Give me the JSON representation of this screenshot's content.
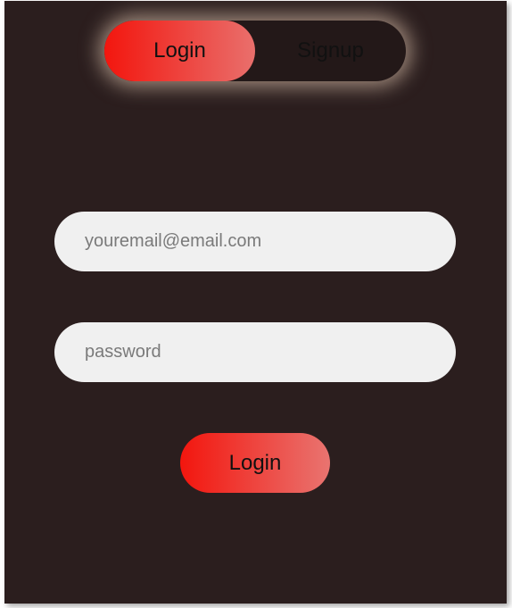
{
  "toggle": {
    "login_label": "Login",
    "signup_label": "Signup",
    "active": "login"
  },
  "form": {
    "email_placeholder": "youremail@email.com",
    "email_value": "",
    "password_placeholder": "password",
    "password_value": "",
    "submit_label": "Login"
  },
  "colors": {
    "background": "#2b1e1e",
    "accent_start": "#f3160e",
    "accent_end": "#e96f6c",
    "field_bg": "#f0f0f0"
  }
}
